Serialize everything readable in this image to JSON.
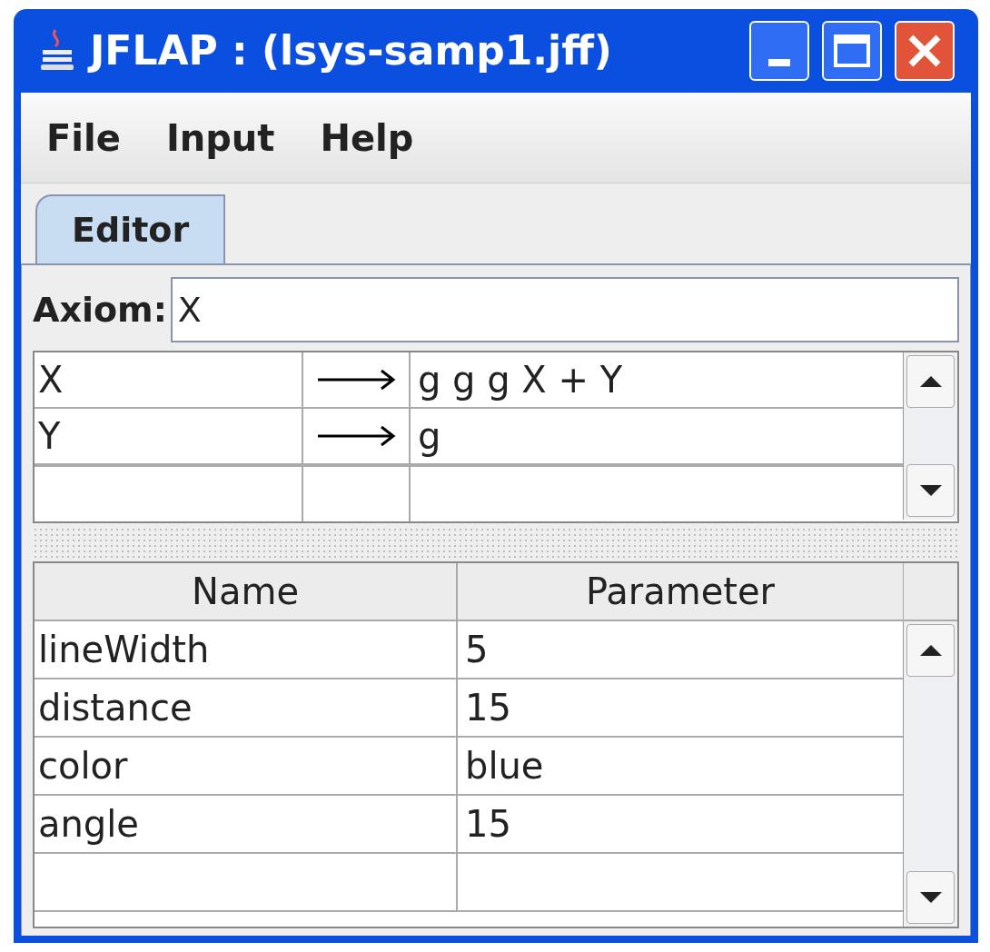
{
  "window": {
    "title": "JFLAP : (lsys-samp1.jff)"
  },
  "menu": [
    "File",
    "Input",
    "Help"
  ],
  "tabs": [
    {
      "label": "Editor",
      "selected": true
    }
  ],
  "axiom": {
    "label": "Axiom:",
    "value": "X"
  },
  "rules": [
    {
      "lhs": "X",
      "rhs": "g g g X + Y"
    },
    {
      "lhs": "Y",
      "rhs": "g"
    }
  ],
  "parameters": {
    "columns": [
      "Name",
      "Parameter"
    ],
    "rows": [
      {
        "name": "lineWidth",
        "value": "5"
      },
      {
        "name": "distance",
        "value": "15"
      },
      {
        "name": "color",
        "value": "blue"
      },
      {
        "name": "angle",
        "value": "15"
      }
    ]
  }
}
